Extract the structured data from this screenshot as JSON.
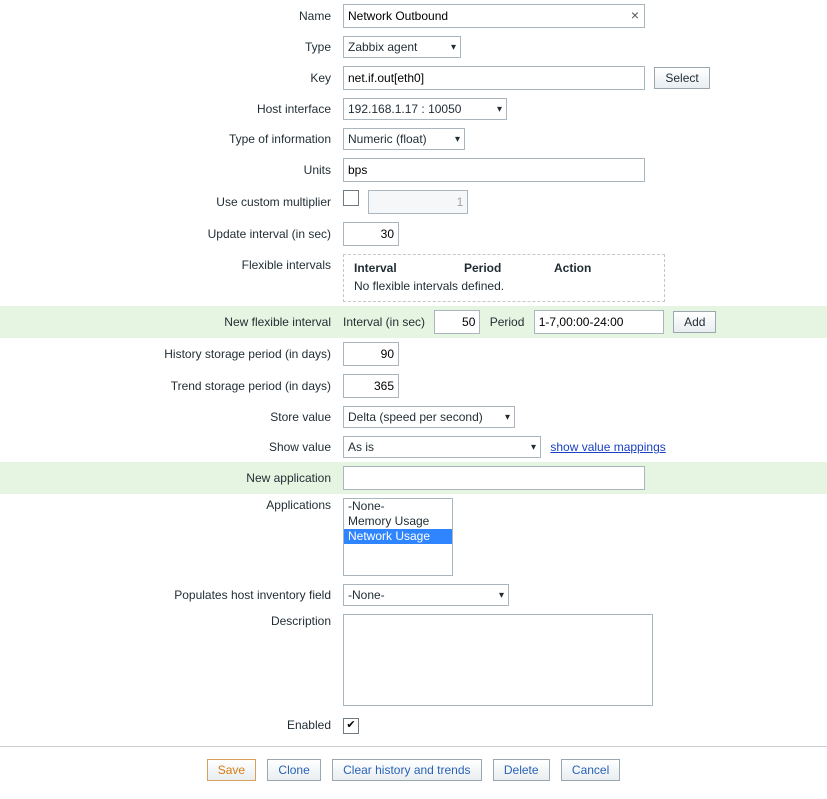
{
  "labels": {
    "name": "Name",
    "type": "Type",
    "key": "Key",
    "host_interface": "Host interface",
    "type_of_information": "Type of information",
    "units": "Units",
    "use_custom_multiplier": "Use custom multiplier",
    "update_interval": "Update interval (in sec)",
    "flexible_intervals": "Flexible intervals",
    "new_flexible_interval": "New flexible interval",
    "history_storage": "History storage period (in days)",
    "trend_storage": "Trend storage period (in days)",
    "store_value": "Store value",
    "show_value": "Show value",
    "new_application": "New application",
    "applications": "Applications",
    "populates_inventory": "Populates host inventory field",
    "description": "Description",
    "enabled": "Enabled"
  },
  "name": "Network Outbound",
  "type": "Zabbix agent",
  "key": "net.if.out[eth0]",
  "select_btn": "Select",
  "host_interface": "192.168.1.17 : 10050",
  "type_of_information": "Numeric (float)",
  "units": "bps",
  "use_custom_multiplier": false,
  "custom_multiplier": "1",
  "update_interval": "30",
  "flex_table": {
    "h_interval": "Interval",
    "h_period": "Period",
    "h_action": "Action",
    "empty": "No flexible intervals defined."
  },
  "new_flex": {
    "interval_label": "Interval (in sec)",
    "interval": "50",
    "period_label": "Period",
    "period": "1-7,00:00-24:00",
    "add": "Add"
  },
  "history_storage": "90",
  "trend_storage": "365",
  "store_value": "Delta (speed per second)",
  "show_value": "As is",
  "show_value_mappings": "show value mappings",
  "new_application": "",
  "applications": [
    {
      "label": "-None-",
      "selected": false
    },
    {
      "label": "Memory Usage",
      "selected": false
    },
    {
      "label": "Network Usage",
      "selected": true
    }
  ],
  "populates_inventory": "-None-",
  "description": "",
  "enabled": true,
  "buttons": {
    "save": "Save",
    "clone": "Clone",
    "clear": "Clear history and trends",
    "delete": "Delete",
    "cancel": "Cancel"
  }
}
